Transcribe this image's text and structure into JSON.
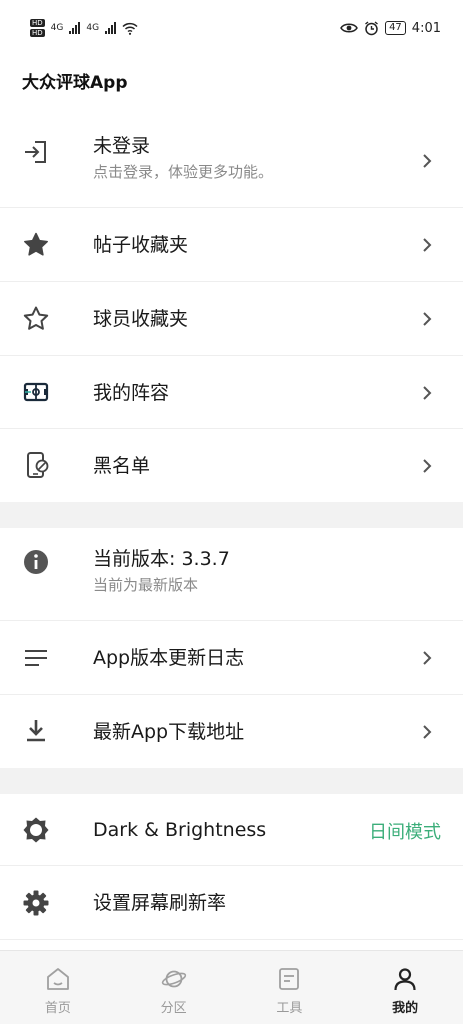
{
  "status_bar": {
    "hd1": "HD",
    "hd2": "HD",
    "net1": "4G",
    "net2": "4G",
    "battery": "47",
    "time": "4:01"
  },
  "app": {
    "title": "大众评球App"
  },
  "account": {
    "title": "未登录",
    "subtitle": "点击登录，体验更多功能。"
  },
  "menu": {
    "post_favorites": "帖子收藏夹",
    "player_favorites": "球员收藏夹",
    "my_lineup": "我的阵容",
    "blacklist": "黑名单"
  },
  "version": {
    "title": "当前版本: 3.3.7",
    "subtitle": "当前为最新版本",
    "changelog": "App版本更新日志",
    "download": "最新App下载地址"
  },
  "settings": {
    "dark_label": "Dark & Brightness",
    "dark_value": "日间模式",
    "refresh_rate": "设置屏幕刷新率"
  },
  "tabbar": {
    "home": "首页",
    "sections": "分区",
    "tools": "工具",
    "mine": "我的"
  },
  "colors": {
    "accent": "#3cae7a",
    "icon": "#444444",
    "subtle": "#8a8a8a"
  }
}
